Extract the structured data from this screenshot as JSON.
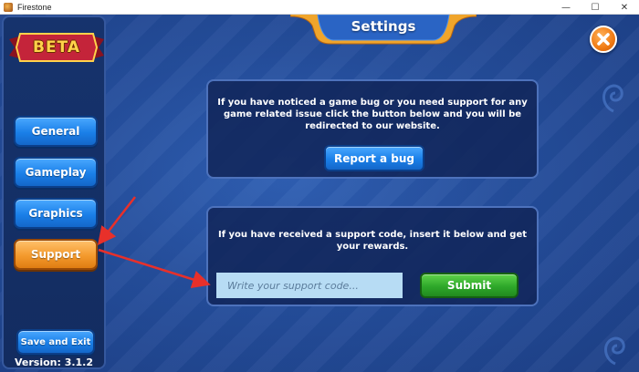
{
  "window": {
    "title": "Firestone",
    "controls": {
      "minimize": "—",
      "maximize": "☐",
      "close": "✕"
    }
  },
  "sidebar": {
    "badge": "BETA",
    "items": [
      {
        "label": "General",
        "active": false
      },
      {
        "label": "Gameplay",
        "active": false
      },
      {
        "label": "Graphics",
        "active": false
      },
      {
        "label": "Support",
        "active": true
      }
    ],
    "save_exit_label": "Save and Exit",
    "version": "Version: 3.1.2"
  },
  "header": {
    "title": "Settings"
  },
  "bug_panel": {
    "text": "If you have noticed a game bug or you need support for any game related issue click the button below and you will be redirected to our website.",
    "button_label": "Report a bug"
  },
  "code_panel": {
    "text": "If you have received a support code, insert it below and get your rewards.",
    "input_placeholder": "Write your support code...",
    "input_value": "",
    "submit_label": "Submit"
  },
  "colors": {
    "background": "#244d9b",
    "nav_button": "#1a7fe8",
    "active_button": "#f49a2d",
    "submit_button": "#2ea82a",
    "annotation_arrow": "#e8302a"
  }
}
